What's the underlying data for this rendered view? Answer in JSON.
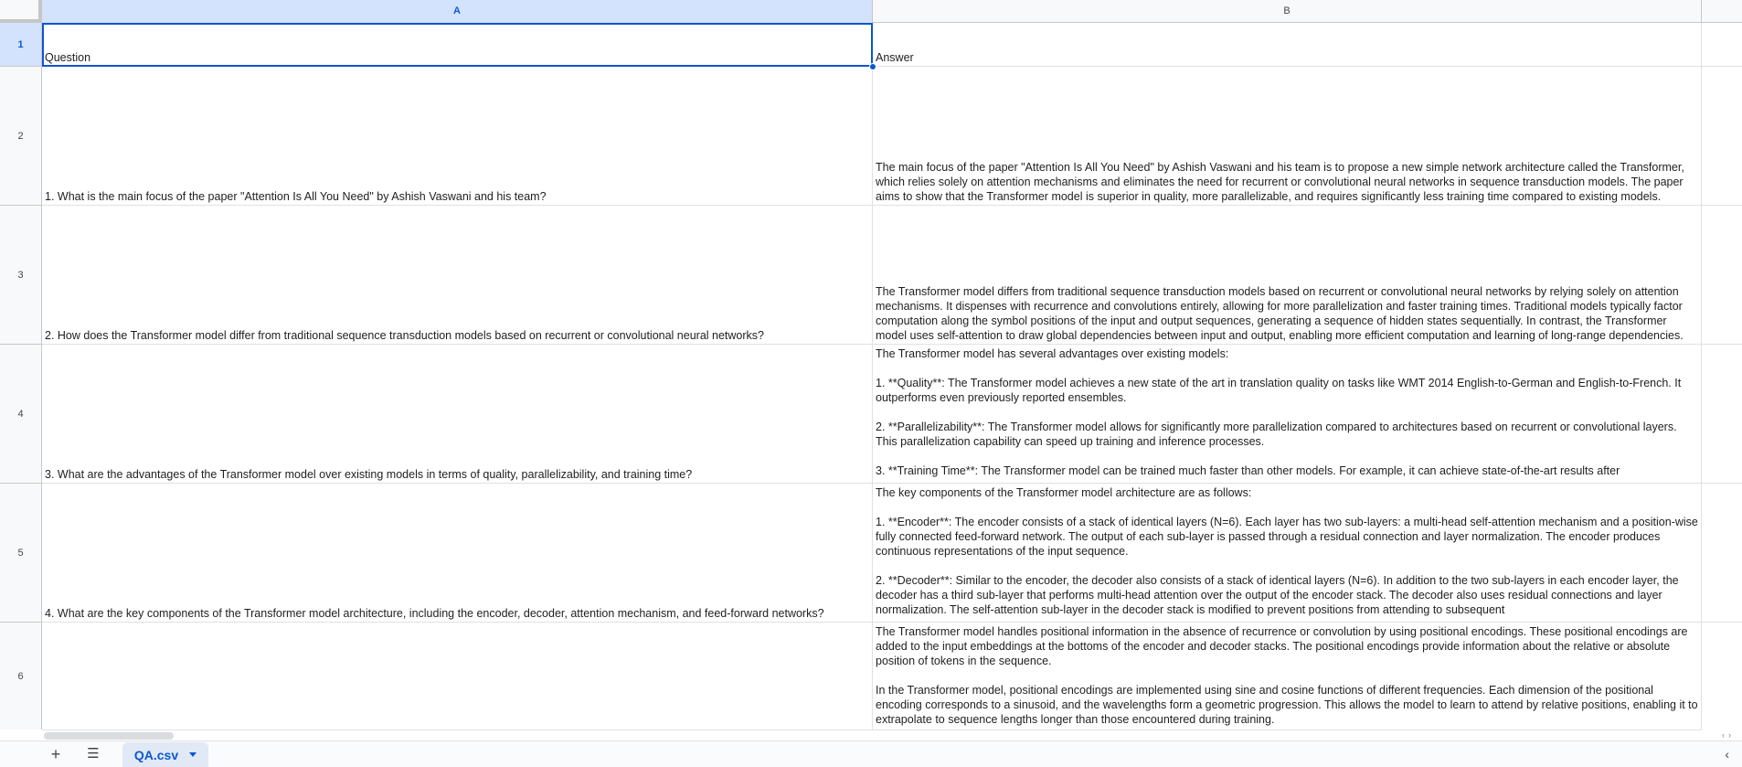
{
  "columns": [
    {
      "letter": "A",
      "selected": true
    },
    {
      "letter": "B",
      "selected": false
    }
  ],
  "rows": [
    {
      "num": "1",
      "selected": true,
      "question": "Question",
      "answer": "Answer"
    },
    {
      "num": "2",
      "selected": false,
      "question": "1. What is the main focus of the paper \"Attention Is All You Need\" by Ashish Vaswani and his team?",
      "answer": "The main focus of the paper \"Attention Is All You Need\" by Ashish Vaswani and his team is to propose a new simple network architecture called the Transformer, which relies solely on attention mechanisms and eliminates the need for recurrent or convolutional neural networks in sequence transduction models. The paper aims to show that the Transformer model is superior in quality, more parallelizable, and requires significantly less training time compared to existing models."
    },
    {
      "num": "3",
      "selected": false,
      "question": "2. How does the Transformer model differ from traditional sequence transduction models based on recurrent or convolutional neural networks?",
      "answer": "The Transformer model differs from traditional sequence transduction models based on recurrent or convolutional neural networks by relying solely on attention mechanisms. It dispenses with recurrence and convolutions entirely, allowing for more parallelization and faster training times. Traditional models typically factor computation along the symbol positions of the input and output sequences, generating a sequence of hidden states sequentially. In contrast, the Transformer model uses self-attention to draw global dependencies between input and output, enabling more efficient computation and learning of long-range dependencies."
    },
    {
      "num": "4",
      "selected": false,
      "question": "3. What are the advantages of the Transformer model over existing models in terms of quality, parallelizability, and training time?",
      "answer": "The Transformer model has several advantages over existing models:\n\n1. **Quality**: The Transformer model achieves a new state of the art in translation quality on tasks like WMT 2014 English-to-German and English-to-French. It outperforms even previously reported ensembles.\n\n2. **Parallelizability**: The Transformer model allows for significantly more parallelization compared to architectures based on recurrent or convolutional layers. This parallelization capability can speed up training and inference processes.\n\n3. **Training Time**: The Transformer model can be trained much faster than other models. For example, it can achieve state-of-the-art results after"
    },
    {
      "num": "5",
      "selected": false,
      "question": "4. What are the key components of the Transformer model architecture, including the encoder, decoder, attention mechanism, and feed-forward networks?",
      "answer": "The key components of the Transformer model architecture are as follows:\n\n1. **Encoder**: The encoder consists of a stack of identical layers (N=6). Each layer has two sub-layers: a multi-head self-attention mechanism and a position-wise fully connected feed-forward network. The output of each sub-layer is passed through a residual connection and layer normalization. The encoder produces continuous representations of the input sequence.\n\n2. **Decoder**: Similar to the encoder, the decoder also consists of a stack of identical layers (N=6). In addition to the two sub-layers in each encoder layer, the decoder has a third sub-layer that performs multi-head attention over the output of the encoder stack. The decoder also uses residual connections and layer normalization. The self-attention sub-layer in the decoder stack is modified to prevent positions from attending to subsequent"
    },
    {
      "num": "6",
      "selected": false,
      "question": "",
      "answer": "The Transformer model handles positional information in the absence of recurrence or convolution by using positional encodings. These positional encodings are added to the input embeddings at the bottoms of the encoder and decoder stacks. The positional encodings provide information about the relative or absolute position of tokens in the sequence.\n\nIn the Transformer model, positional encodings are implemented using sine and cosine functions of different frequencies. Each dimension of the positional encoding corresponds to a sinusoid, and the wavelengths form a geometric progression. This allows the model to learn to attend by relative positions, enabling it to extrapolate to sequence lengths longer than those encountered during training."
    }
  ],
  "sheet_bar": {
    "add_icon": "plus-icon",
    "add_glyph": "+",
    "all_sheets_icon": "menu-icon",
    "all_sheets_glyph": "☰",
    "tab_label": "QA.csv",
    "explore_glyph": "‹",
    "scroll_left_glyph": "‹",
    "scroll_right_glyph": "›"
  },
  "colors": {
    "accent": "#0b57d0",
    "selected_header": "#d3e3fd",
    "grid": "#e1e1e1"
  }
}
